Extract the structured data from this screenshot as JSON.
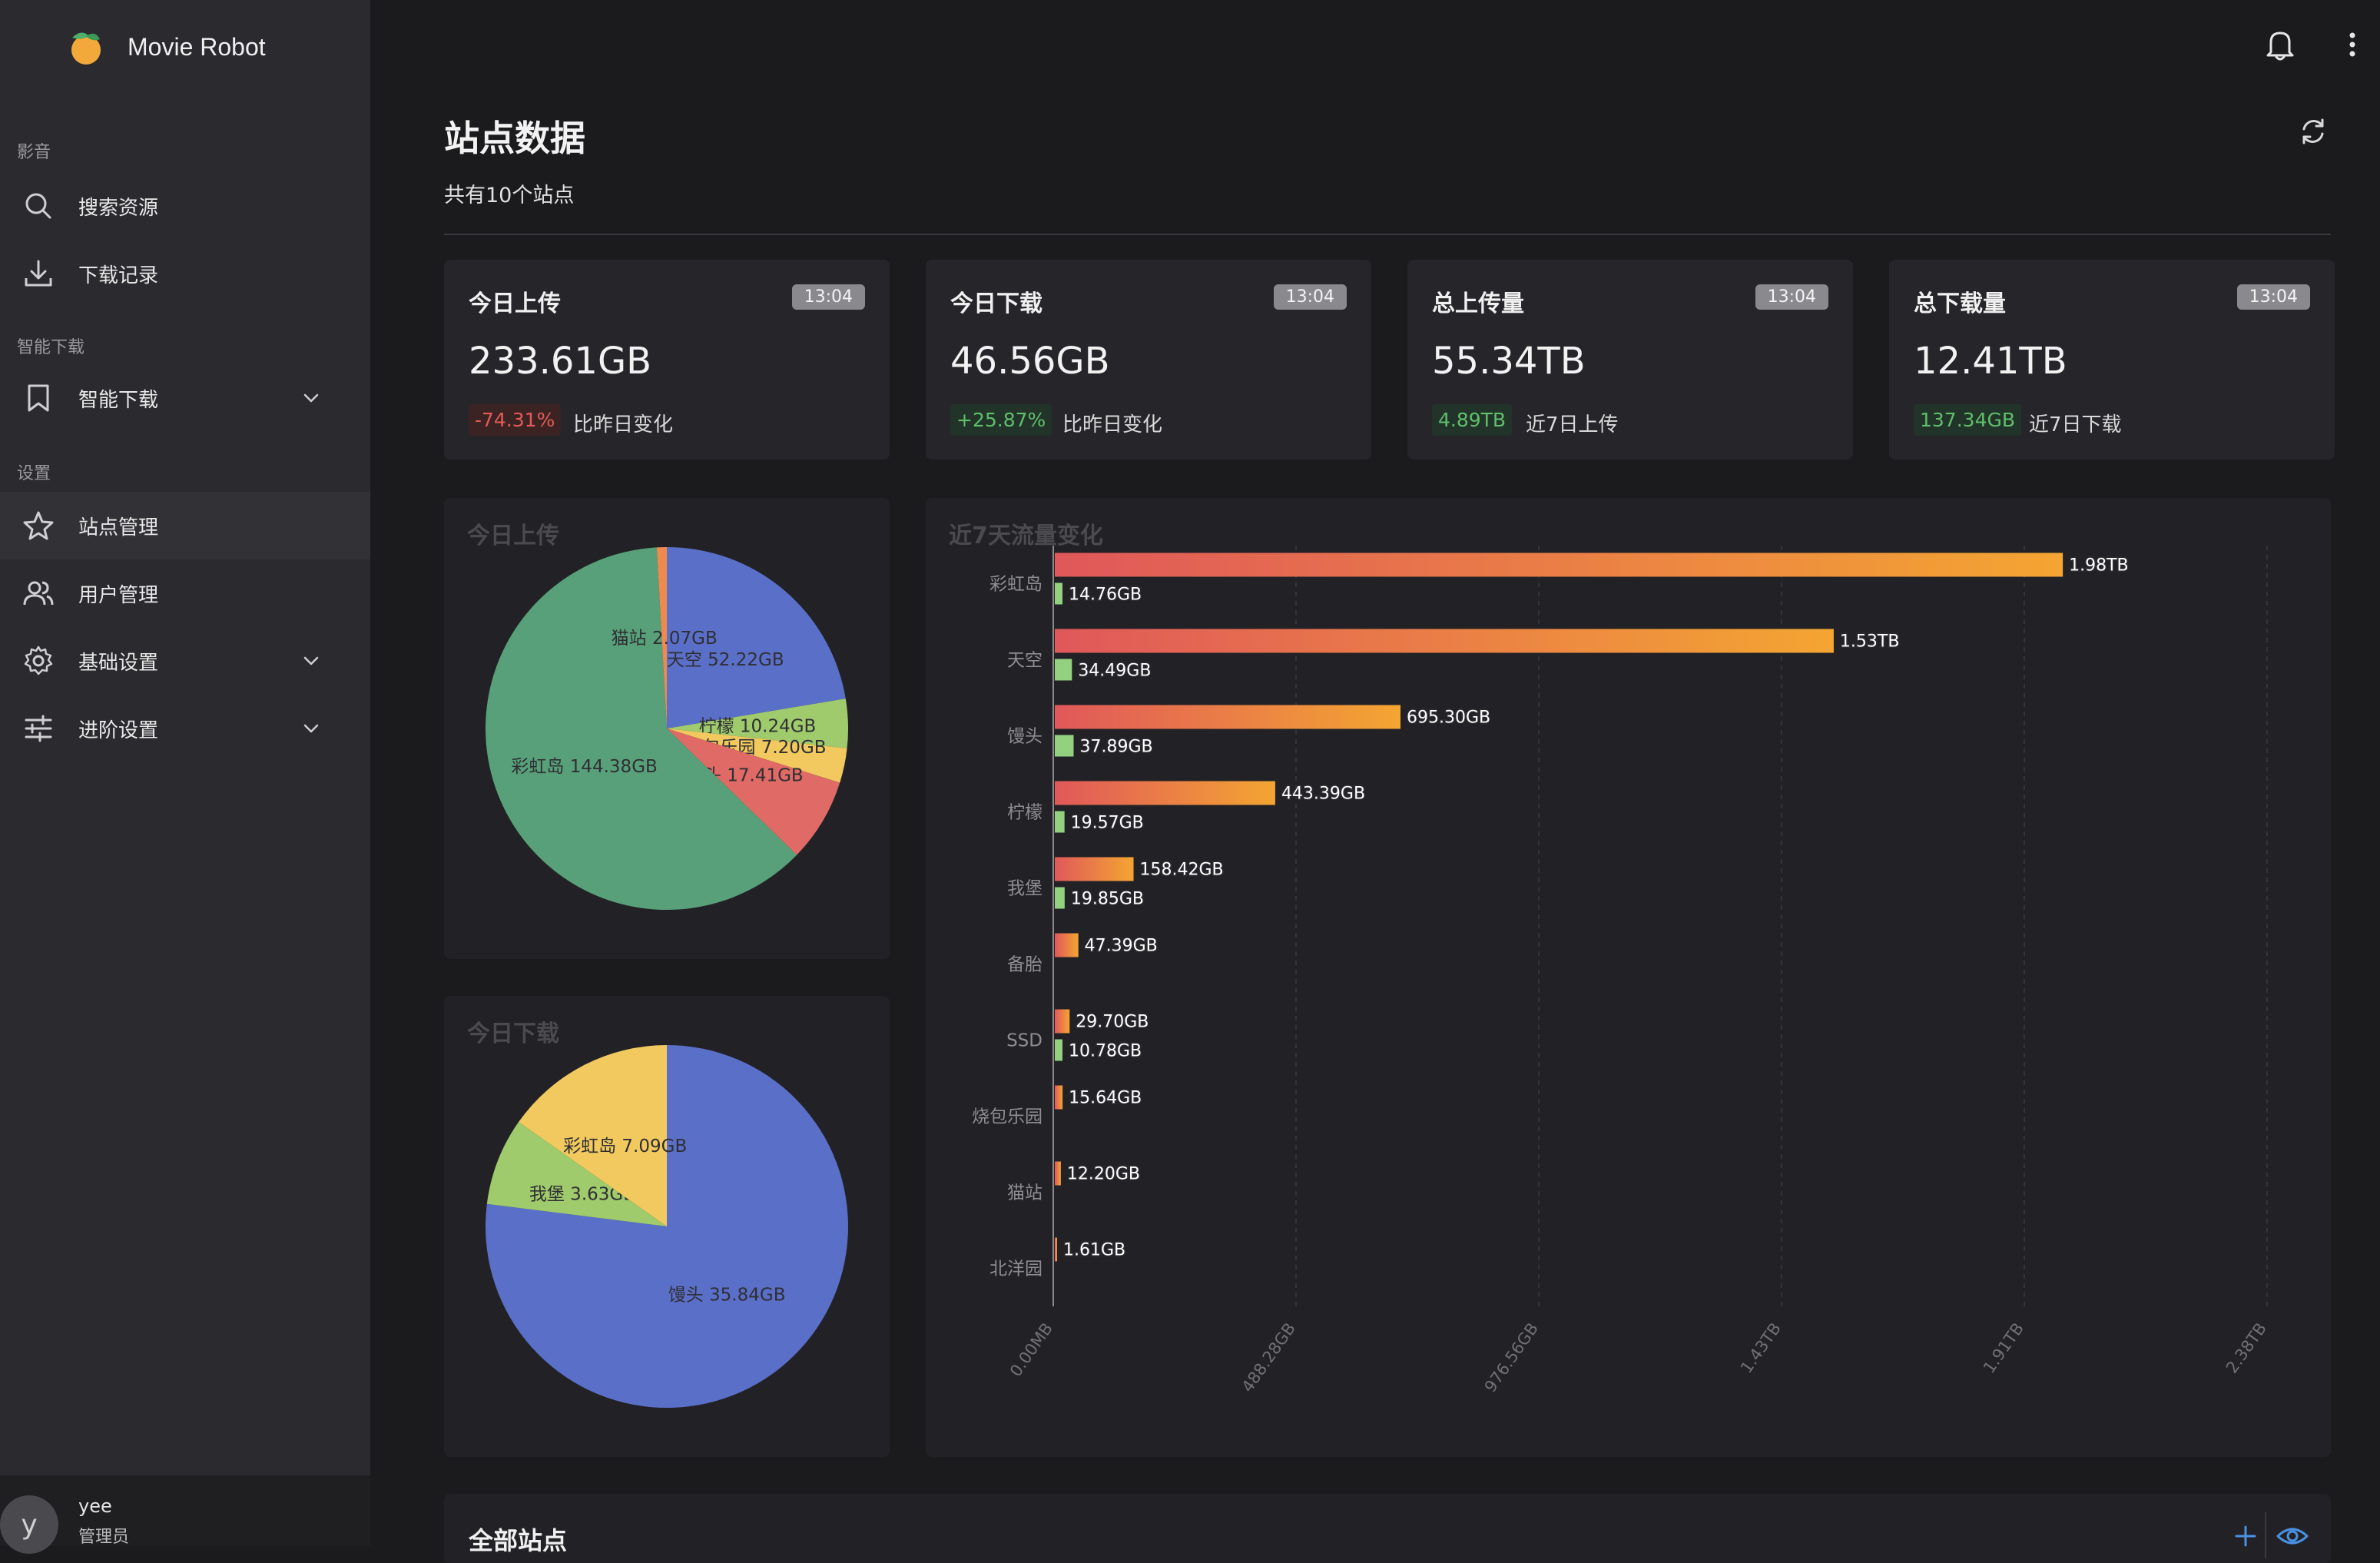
{
  "app": {
    "name": "Movie Robot"
  },
  "sidebar": {
    "sections": [
      {
        "title": "影音"
      },
      {
        "title": "智能下载"
      },
      {
        "title": "设置"
      }
    ],
    "items": [
      {
        "label": "搜索资源",
        "icon": "search-icon"
      },
      {
        "label": "下载记录",
        "icon": "download-icon"
      },
      {
        "label": "智能下载",
        "icon": "bookmark-icon"
      },
      {
        "label": "站点管理",
        "icon": "star-icon",
        "active": true
      },
      {
        "label": "用户管理",
        "icon": "users-icon"
      },
      {
        "label": "基础设置",
        "icon": "gear-icon"
      },
      {
        "label": "进阶设置",
        "icon": "sliders-icon"
      }
    ],
    "user": {
      "avatar_letter": "y",
      "name": "yee",
      "role": "管理员"
    }
  },
  "page": {
    "title": "站点数据",
    "subtitle": "共有10个站点"
  },
  "cards": [
    {
      "title": "今日上传",
      "time": "13:04",
      "value": "233.61GB",
      "badge": "-74.31%",
      "badge_type": "red",
      "note": "比昨日变化"
    },
    {
      "title": "今日下载",
      "time": "13:04",
      "value": "46.56GB",
      "badge": "+25.87%",
      "badge_type": "green",
      "note": "比昨日变化"
    },
    {
      "title": "总上传量",
      "time": "13:04",
      "value": "55.34TB",
      "badge": "4.89TB",
      "badge_type": "green",
      "note": "近7日上传"
    },
    {
      "title": "总下载量",
      "time": "13:04",
      "value": "12.41TB",
      "badge": "137.34GB",
      "badge_type": "green",
      "note": "近7日下载"
    }
  ],
  "colors": {
    "green_slice": "#58a07a",
    "blue_slice": "#5a6fc8",
    "lime_slice": "#9fcb6c",
    "yellow_slice": "#f1c95e",
    "red_slice": "#df6a66",
    "orange_slice": "#ee8a4e",
    "bar_start": "#e0585a",
    "bar_end": "#f4a532",
    "bar_download": "#93d07f"
  },
  "chart_data": [
    {
      "type": "pie",
      "title": "今日上传",
      "slices": [
        {
          "label": "天空",
          "value": 52.22,
          "display": "天空 52.22GB",
          "color": "#5a6fc8"
        },
        {
          "label": "柠檬",
          "value": 10.24,
          "display": "柠檬 10.24GB",
          "color": "#9fcb6c"
        },
        {
          "label": "烧包乐园",
          "value": 7.2,
          "display": "烧包乐园 7.20GB",
          "color": "#f1c95e"
        },
        {
          "label": "馒头",
          "value": 17.41,
          "display": "馒头 17.41GB",
          "color": "#df6a66"
        },
        {
          "label": "彩虹岛",
          "value": 144.38,
          "display": "彩虹岛 144.38GB",
          "color": "#58a07a"
        },
        {
          "label": "猫站",
          "value": 2.07,
          "display": "猫站 2.07GB",
          "color": "#ee8a4e"
        }
      ]
    },
    {
      "type": "pie",
      "title": "今日下载",
      "slices": [
        {
          "label": "馒头",
          "value": 35.84,
          "display": "馒头 35.84GB",
          "color": "#5a6fc8"
        },
        {
          "label": "我堡",
          "value": 3.63,
          "display": "我堡 3.63GB",
          "color": "#9fcb6c"
        },
        {
          "label": "彩虹岛",
          "value": 7.09,
          "display": "彩虹岛 7.09GB",
          "color": "#f1c95e"
        }
      ]
    },
    {
      "type": "bar",
      "orientation": "horizontal",
      "title": "近7天流量变化",
      "categories": [
        "彩虹岛",
        "天空",
        "馒头",
        "柠檬",
        "我堡",
        "备胎",
        "SSD",
        "烧包乐园",
        "猫站",
        "北洋园"
      ],
      "unit": "GB",
      "series": [
        {
          "role": "upload",
          "values": [
            2027.5,
            1566.7,
            695.3,
            443.39,
            158.42,
            47.39,
            29.7,
            15.64,
            12.2,
            1.61
          ],
          "labels": [
            "1.98TB",
            "1.53TB",
            "695.30GB",
            "443.39GB",
            "158.42GB",
            "47.39GB",
            "29.70GB",
            "15.64GB",
            "12.20GB",
            "1.61GB"
          ]
        },
        {
          "role": "download",
          "values": [
            14.76,
            34.49,
            37.89,
            19.57,
            19.85,
            0,
            10.78,
            0,
            0,
            0
          ],
          "labels": [
            "14.76GB",
            "34.49GB",
            "37.89GB",
            "19.57GB",
            "19.85GB",
            "",
            "10.78GB",
            "",
            "",
            ""
          ]
        }
      ],
      "xlim": [
        0,
        2441.4
      ],
      "x_ticks": [
        "0.00MB",
        "488.28GB",
        "976.56GB",
        "1.43TB",
        "1.91TB",
        "2.38TB"
      ]
    }
  ],
  "bottom_panel": {
    "title": "全部站点"
  }
}
